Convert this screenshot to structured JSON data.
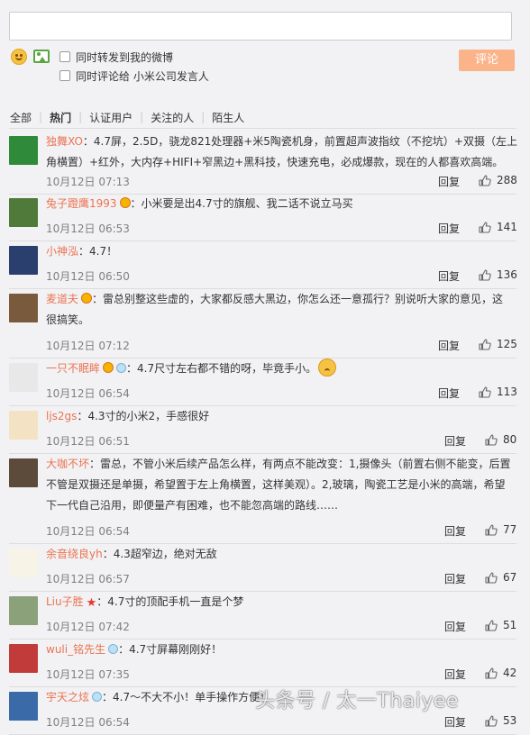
{
  "compose": {
    "input_value": "",
    "forward_label": "同时转发到我的微博",
    "comment_to_label": "同时评论给 小米公司发言人",
    "submit_label": "评论",
    "emoji_icon": "smiley-icon",
    "image_icon": "image-icon"
  },
  "tabs": [
    {
      "label": "全部",
      "active": false
    },
    {
      "label": "热门",
      "active": true
    },
    {
      "label": "认证用户",
      "active": false
    },
    {
      "label": "关注的人",
      "active": false
    },
    {
      "label": "陌生人",
      "active": false
    }
  ],
  "reply_label": "回复",
  "comments": [
    {
      "name": "独舞XO",
      "text_lines": [
        "：4.7屏，2.5D，骁龙821处理器+米5陶瓷机身，前置超声波指纹（不挖坑）+双摄（左上",
        "角横置）+红外，大内存+HIFI+窄黑边+黑科技，快速充电，必成爆款，现在的人都喜欢高端。"
      ],
      "time": "10月12日 07:13",
      "likes": "288",
      "badges": [],
      "avatar_color": "#2f8a3a"
    },
    {
      "name": "兔子蹬鹰1993",
      "text_lines": [
        "：小米要是出4.7寸的旗舰、我二话不说立马买"
      ],
      "time": "10月12日 06:53",
      "likes": "141",
      "badges": [
        "vip"
      ],
      "avatar_color": "#4f7a3a"
    },
    {
      "name": "小神泓",
      "text_lines": [
        "：4.7！"
      ],
      "time": "10月12日 06:50",
      "likes": "136",
      "badges": [],
      "avatar_color": "#2b3f6e"
    },
    {
      "name": "麦道夫",
      "text_lines": [
        "：雷总别整这些虚的，大家都反感大黑边，你怎么还一意孤行？别说听大家的意见，这",
        "很搞笑。"
      ],
      "time": "10月12日 07:12",
      "likes": "125",
      "badges": [
        "vip"
      ],
      "avatar_color": "#7a5a3c"
    },
    {
      "name": "一只不眠眸",
      "text_lines": [
        "：4.7尺寸左右都不错的呀，毕竟手小。"
      ],
      "time": "10月12日 06:54",
      "likes": "113",
      "badges": [
        "vip",
        "member"
      ],
      "avatar_color": "#e8e8e8",
      "sticker": true
    },
    {
      "name": "ljs2gs",
      "text_lines": [
        "：4.3寸的小米2，手感很好"
      ],
      "time": "10月12日 06:51",
      "likes": "80",
      "badges": [],
      "avatar_color": "#f4e2c4"
    },
    {
      "name": "大咖不坏",
      "text_lines": [
        "：雷总，不管小米后续产品怎么样，有两点不能改变：1,摄像头（前置右侧不能变，后置",
        "不管是双摄还是单摄，希望置于左上角横置，这样美观）。2,玻璃，陶瓷工艺是小米的高端，希望",
        "下一代自己沿用，即便量产有困难，也不能忽高端的路线……"
      ],
      "time": "10月12日 06:54",
      "likes": "77",
      "badges": [],
      "avatar_color": "#5c4a3a"
    },
    {
      "name": "余音绕良yh",
      "text_lines": [
        "：4.3超窄边，绝对无敌"
      ],
      "time": "10月12日 06:57",
      "likes": "67",
      "badges": [],
      "avatar_color": "#f7f3e6"
    },
    {
      "name": "Liu子胜",
      "text_lines": [
        "：4.7寸的顶配手机一直是个梦"
      ],
      "time": "10月12日 07:42",
      "likes": "51",
      "badges": [
        "star"
      ],
      "avatar_color": "#8aa17a"
    },
    {
      "name": "wuli_铭先生",
      "text_lines": [
        "：4.7寸屏幕刚刚好！"
      ],
      "time": "10月12日 07:35",
      "likes": "42",
      "badges": [
        "member"
      ],
      "avatar_color": "#c23b3b"
    },
    {
      "name": "宇天之炫",
      "text_lines": [
        "：4.7～不大不小！单手操作方便！"
      ],
      "time": "10月12日 06:54",
      "likes": "53",
      "badges": [
        "member"
      ],
      "avatar_color": "#3a6aa8"
    }
  ],
  "watermark": "头条号 / 太一Thaiyee"
}
